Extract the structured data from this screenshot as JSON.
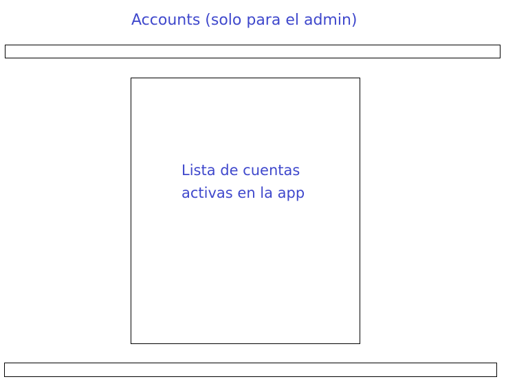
{
  "header": {
    "title": "Accounts (solo para el admin)"
  },
  "main": {
    "accounts_list": {
      "label_line_1": "Lista de cuentas",
      "label_line_2": "activas en la app"
    }
  },
  "colors": {
    "text_accent": "#3f48cc",
    "border": "#000000",
    "background": "#ffffff"
  }
}
